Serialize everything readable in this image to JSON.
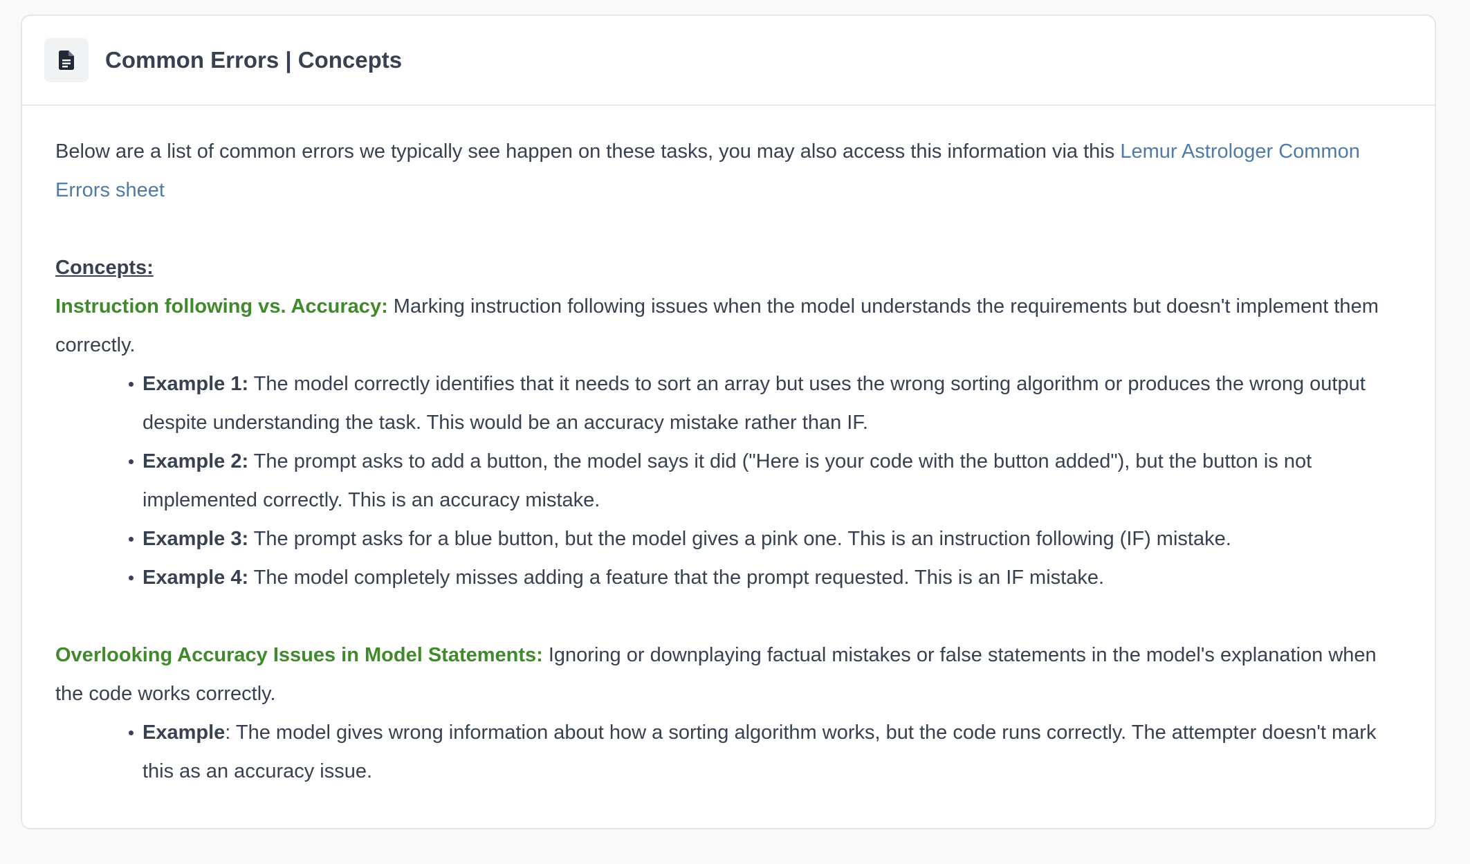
{
  "header": {
    "title": "Common Errors | Concepts",
    "icon": "document-icon"
  },
  "intro": {
    "text": "Below are a list of common errors we typically see happen on these tasks, you may also access this information via this ",
    "link_text": "Lemur Astrologer Common Errors sheet"
  },
  "concepts_heading": "Concepts:",
  "sections": [
    {
      "title": "Instruction following vs. Accuracy:",
      "description": " Marking instruction following issues when the model understands the requirements but doesn't implement them correctly.",
      "examples": [
        {
          "label": "Example 1:",
          "text": " The model correctly identifies that it needs to sort an array but uses the wrong sorting algorithm or produces the wrong output despite understanding the task. This would be an accuracy mistake rather than IF."
        },
        {
          "label": "Example 2:",
          "text": " The prompt asks to add a button, the model says it did (\"Here is your code with the button added\"), but the button is not implemented correctly. This is an accuracy mistake."
        },
        {
          "label": "Example 3:",
          "text": " The prompt asks for a blue button, but the model gives a pink one. This is an instruction following (IF) mistake."
        },
        {
          "label": "Example 4:",
          "text": " The model completely misses adding a feature that the prompt requested. This is an IF mistake."
        }
      ]
    },
    {
      "title": "Overlooking Accuracy Issues in Model Statements:",
      "description": " Ignoring or downplaying factual mistakes or false statements in the model's explanation when the code works correctly.",
      "examples": [
        {
          "label": "Example",
          "text": ": The model gives wrong information about how a sorting algorithm works, but the code runs correctly. The attempter doesn't mark this as an accuracy issue."
        }
      ]
    }
  ],
  "colors": {
    "accent_green": "#3f8a2a",
    "link_blue": "#4f7ba8",
    "text": "#374151"
  }
}
